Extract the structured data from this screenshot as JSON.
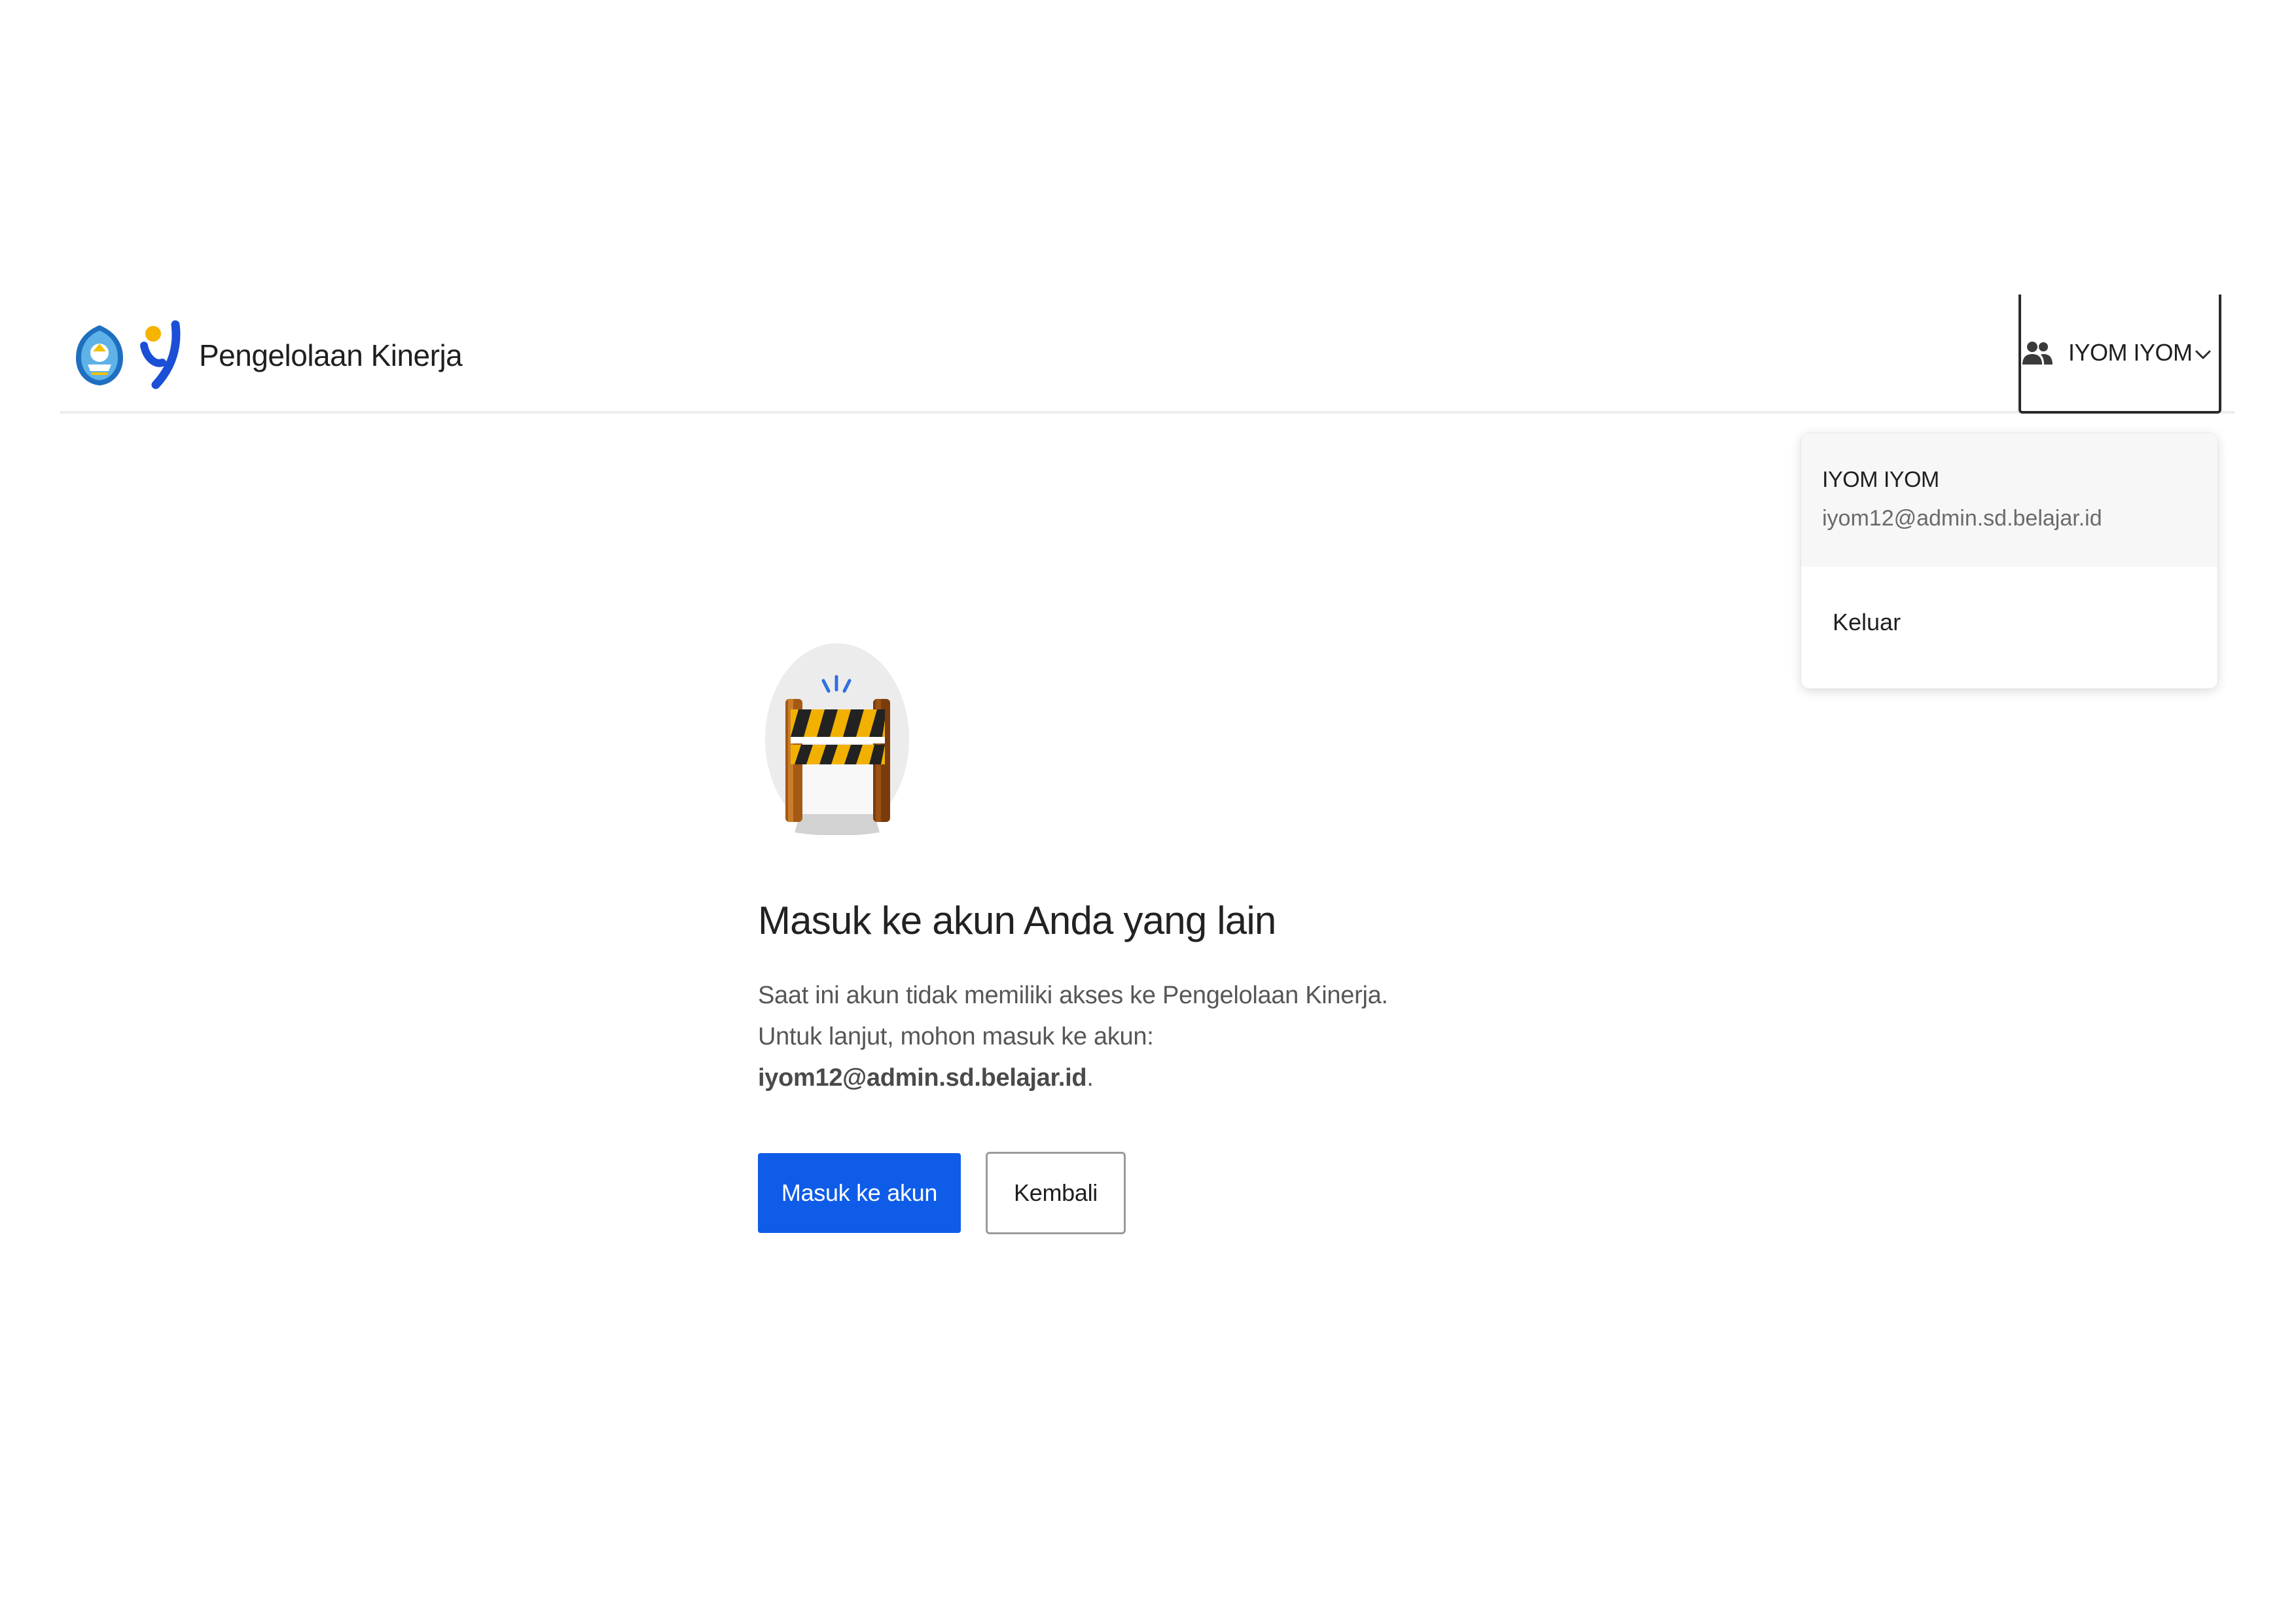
{
  "header": {
    "app_title": "Pengelolaan Kinerja",
    "logo_emblem_icon": "tut-wuri-handayani-emblem-icon",
    "logo_mark_icon": "brand-figure-icon",
    "user_menu": {
      "icon": "people-icon",
      "label": "IYOM IYOM",
      "chevron_icon": "chevron-down-icon"
    }
  },
  "dropdown": {
    "name": "IYOM IYOM",
    "email": "iyom12@admin.sd.belajar.id",
    "logout_label": "Keluar"
  },
  "main": {
    "illustration_icon": "road-barrier-icon",
    "heading": "Masuk ke akun Anda yang lain",
    "description_line1": "Saat ini akun tidak memiliki akses ke Pengelolaan Kinerja.",
    "description_line2": "Untuk lanjut, mohon masuk ke akun:",
    "description_email": "iyom12@admin.sd.belajar.id",
    "description_end": ".",
    "primary_button": "Masuk ke akun",
    "secondary_button": "Kembali"
  },
  "colors": {
    "primary": "#0f5ce8",
    "text": "#1f1f1f",
    "muted_text": "#575757",
    "accent_yellow": "#f2b100",
    "barrier_brown": "#8a4a12"
  }
}
